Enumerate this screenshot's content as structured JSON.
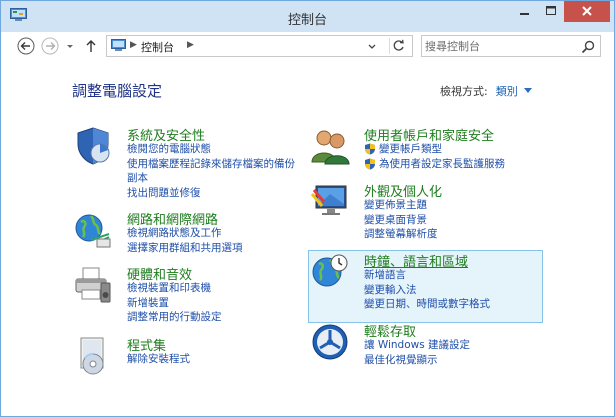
{
  "window": {
    "title": "控制台"
  },
  "address": {
    "breadcrumb": "控制台"
  },
  "search": {
    "placeholder": "搜尋控制台"
  },
  "main": {
    "heading": "調整電腦設定",
    "view_by_label": "檢視方式:",
    "view_by_value": "類別"
  },
  "left_categories": [
    {
      "title": "系統及安全性",
      "links": [
        "檢閱您的電腦狀態",
        "使用檔案歷程記錄來儲存檔案的備份",
        "副本",
        "找出問題並修復"
      ]
    },
    {
      "title": "網路和網際網路",
      "links": [
        "檢視網路狀態及工作",
        "選擇家用群組和共用選項"
      ]
    },
    {
      "title": "硬體和音效",
      "links": [
        "檢視裝置和印表機",
        "新增裝置",
        "調整常用的行動設定"
      ]
    },
    {
      "title": "程式集",
      "links": [
        "解除安裝程式"
      ]
    }
  ],
  "right_categories": [
    {
      "title": "使用者帳戶和家庭安全",
      "links": [
        "變更帳戶類型",
        "為使用者設定家長監護服務"
      ]
    },
    {
      "title": "外觀及個人化",
      "links": [
        "變更佈景主題",
        "變更桌面背景",
        "調整螢幕解析度"
      ]
    },
    {
      "title": "時鐘、語言和區域",
      "links": [
        "新增語言",
        "變更輸入法",
        "變更日期、時間或數字格式"
      ]
    },
    {
      "title": "輕鬆存取",
      "links": [
        "讓 Windows 建議設定",
        "最佳化視覺顯示"
      ]
    }
  ],
  "colors": {
    "titlebar": "#cfe3f5",
    "close_button": "#c7524b",
    "category_title": "#1e7d1e",
    "link": "#1f4fa8",
    "heading": "#1e3287",
    "hover_bg": "#e5f3fb"
  },
  "icons": {
    "titlebar": "control-panel-icon",
    "back": "back-arrow-icon",
    "forward": "forward-arrow-icon",
    "recent": "chevron-down-icon",
    "up": "up-arrow-icon",
    "refresh": "refresh-icon",
    "search": "search-icon"
  }
}
